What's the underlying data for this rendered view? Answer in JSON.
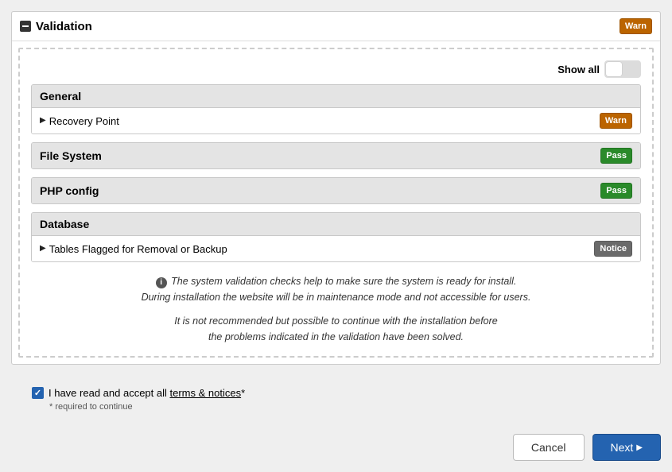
{
  "header": {
    "title": "Validation",
    "status_label": "Warn",
    "status_kind": "warn"
  },
  "show_all_label": "Show all",
  "show_all_on": false,
  "sections": [
    {
      "key": "general",
      "title": "General",
      "badge": null,
      "items": [
        {
          "label": "Recovery Point",
          "badge_label": "Warn",
          "badge_kind": "warn"
        }
      ]
    },
    {
      "key": "file-system",
      "title": "File System",
      "badge_label": "Pass",
      "badge_kind": "pass",
      "items": []
    },
    {
      "key": "php-config",
      "title": "PHP config",
      "badge_label": "Pass",
      "badge_kind": "pass",
      "items": []
    },
    {
      "key": "database",
      "title": "Database",
      "badge": null,
      "items": [
        {
          "label": "Tables Flagged for Removal or Backup",
          "badge_label": "Notice",
          "badge_kind": "notice"
        }
      ]
    }
  ],
  "info": {
    "line1": "The system validation checks help to make sure the system is ready for install.",
    "line2": "During installation the website will be in maintenance mode and not accessible for users.",
    "line3": "It is not recommended but possible to continue with the installation before",
    "line4": "the problems indicated in the validation have been solved."
  },
  "terms": {
    "checked": true,
    "label_prefix": "I have read and accept all ",
    "link_label": "terms & notices",
    "asterisk": "*",
    "required_note": "* required to continue"
  },
  "buttons": {
    "cancel": "Cancel",
    "next": "Next"
  }
}
